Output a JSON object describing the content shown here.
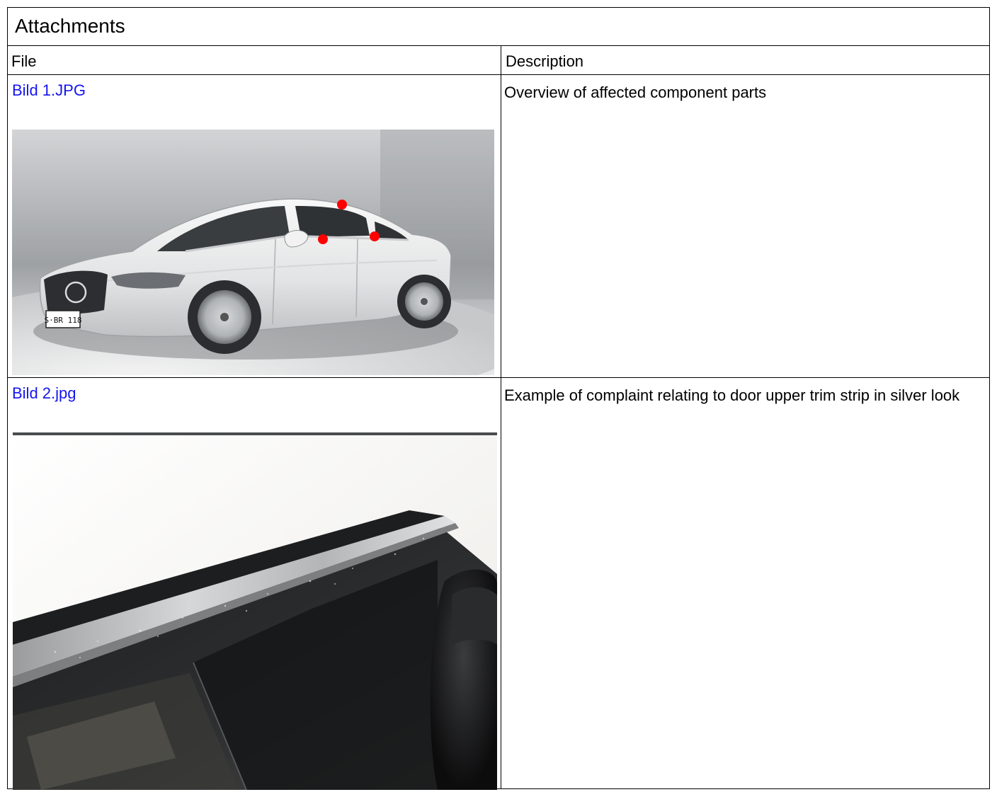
{
  "title": "Attachments",
  "columns": {
    "file": "File",
    "description": "Description"
  },
  "rows": [
    {
      "file_name": "Bild 1.JPG",
      "description": "Overview of affected component parts",
      "plate_text": "S·BR 118"
    },
    {
      "file_name": "Bild 2.jpg",
      "description": "Example of complaint relating to door upper trim strip in silver look"
    }
  ],
  "colors": {
    "link": "#1515ee",
    "marker": "#ff0000",
    "border": "#000000"
  }
}
